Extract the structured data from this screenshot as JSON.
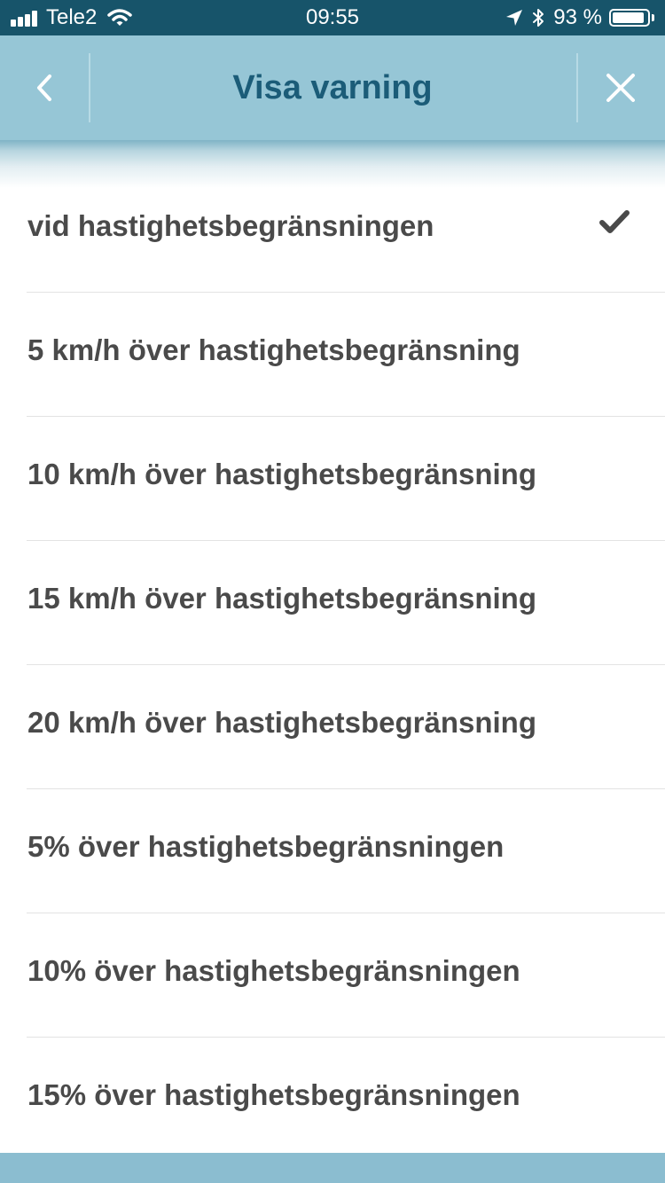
{
  "status_bar": {
    "carrier": "Tele2",
    "time": "09:55",
    "battery_text": "93 %",
    "battery_level": 0.93
  },
  "nav": {
    "title": "Visa varning"
  },
  "options": [
    {
      "label": "vid hastighetsbegränsningen",
      "selected": true
    },
    {
      "label": "5 km/h över hastighetsbegränsning",
      "selected": false
    },
    {
      "label": "10 km/h över hastighetsbegränsning",
      "selected": false
    },
    {
      "label": "15 km/h över hastighetsbegränsning",
      "selected": false
    },
    {
      "label": "20 km/h över hastighetsbegränsning",
      "selected": false
    },
    {
      "label": "5% över hastighetsbegränsningen",
      "selected": false
    },
    {
      "label": "10% över hastighetsbegränsningen",
      "selected": false
    },
    {
      "label": "15% över hastighetsbegränsningen",
      "selected": false
    }
  ],
  "colors": {
    "status_bar": "#17546a",
    "nav_bar": "#96c6d6",
    "title_text": "#1b5c78",
    "option_text": "#4a4a4a",
    "checkmark": "#4a4a4a"
  },
  "icons": {
    "back": "chevron-left-icon",
    "close": "close-icon",
    "selected": "checkmark-icon"
  }
}
